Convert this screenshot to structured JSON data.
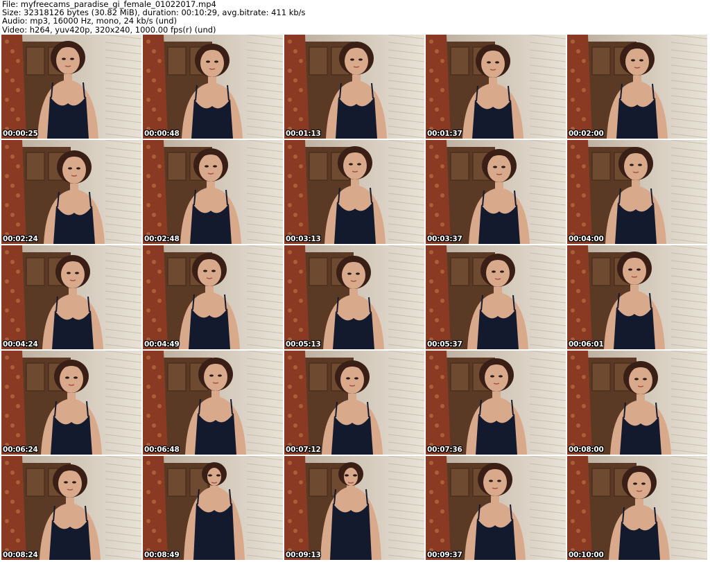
{
  "header": {
    "file_line": "File: myfreecams_paradise_gi_female_01022017.mp4",
    "size_line": "Size: 32318126 bytes (30.82 MiB), duration: 00:10:29, avg.bitrate: 411 kb/s",
    "audio_line": "Audio: mp3, 16000 Hz, mono, 24 kb/s (und)",
    "video_line": "Video: h264, yuv420p, 320x240, 1000.00 fps(r) (und)"
  },
  "thumbnails": [
    {
      "timestamp": "00:00:25",
      "icon": "webcam-frame-icon"
    },
    {
      "timestamp": "00:00:48",
      "icon": "webcam-frame-icon"
    },
    {
      "timestamp": "00:01:13",
      "icon": "webcam-frame-icon"
    },
    {
      "timestamp": "00:01:37",
      "icon": "webcam-frame-icon"
    },
    {
      "timestamp": "00:02:00",
      "icon": "webcam-frame-icon"
    },
    {
      "timestamp": "00:02:24",
      "icon": "webcam-frame-icon"
    },
    {
      "timestamp": "00:02:48",
      "icon": "webcam-frame-icon"
    },
    {
      "timestamp": "00:03:13",
      "icon": "webcam-frame-icon"
    },
    {
      "timestamp": "00:03:37",
      "icon": "webcam-frame-icon"
    },
    {
      "timestamp": "00:04:00",
      "icon": "webcam-frame-icon"
    },
    {
      "timestamp": "00:04:24",
      "icon": "webcam-frame-icon"
    },
    {
      "timestamp": "00:04:49",
      "icon": "webcam-frame-icon"
    },
    {
      "timestamp": "00:05:13",
      "icon": "webcam-frame-icon"
    },
    {
      "timestamp": "00:05:37",
      "icon": "webcam-frame-icon"
    },
    {
      "timestamp": "00:06:01",
      "icon": "webcam-frame-icon"
    },
    {
      "timestamp": "00:06:24",
      "icon": "webcam-frame-icon"
    },
    {
      "timestamp": "00:06:48",
      "icon": "webcam-frame-icon"
    },
    {
      "timestamp": "00:07:12",
      "icon": "webcam-frame-icon"
    },
    {
      "timestamp": "00:07:36",
      "icon": "webcam-frame-icon"
    },
    {
      "timestamp": "00:08:00",
      "icon": "webcam-frame-icon"
    },
    {
      "timestamp": "00:08:24",
      "icon": "webcam-frame-icon"
    },
    {
      "timestamp": "00:08:49",
      "icon": "webcam-frame-icon"
    },
    {
      "timestamp": "00:09:13",
      "icon": "webcam-frame-icon"
    },
    {
      "timestamp": "00:09:37",
      "icon": "webcam-frame-icon"
    },
    {
      "timestamp": "00:10:00",
      "icon": "webcam-frame-icon"
    }
  ],
  "colors": {
    "background": "#ffffff",
    "header_text": "#000000",
    "timestamp_text": "#ffffff",
    "timestamp_outline": "#000000",
    "curtain": "#8a3a22",
    "wall": "#d9d2c4",
    "cabinet": "#5a3a24",
    "top": "#141a2e",
    "skin": "#d9a98c",
    "hair": "#3a1f16"
  }
}
